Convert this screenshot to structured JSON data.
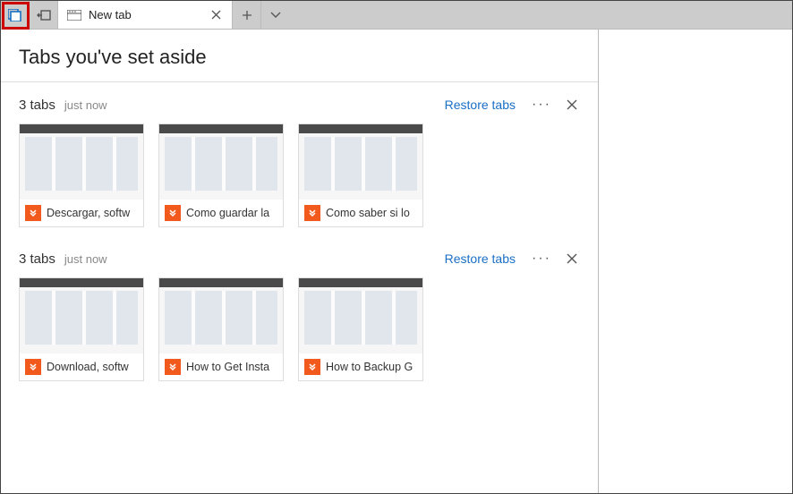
{
  "toolbar": {
    "tab_title": "New tab"
  },
  "aside": {
    "title": "Tabs you've set aside",
    "groups": [
      {
        "count_label": "3 tabs",
        "time_label": "just now",
        "restore_label": "Restore tabs",
        "items": [
          {
            "label": "Descargar, softw"
          },
          {
            "label": "Como guardar la"
          },
          {
            "label": "Como saber si lo"
          }
        ]
      },
      {
        "count_label": "3 tabs",
        "time_label": "just now",
        "restore_label": "Restore tabs",
        "items": [
          {
            "label": "Download, softw"
          },
          {
            "label": "How to Get Insta"
          },
          {
            "label": "How to Backup G"
          }
        ]
      }
    ]
  }
}
